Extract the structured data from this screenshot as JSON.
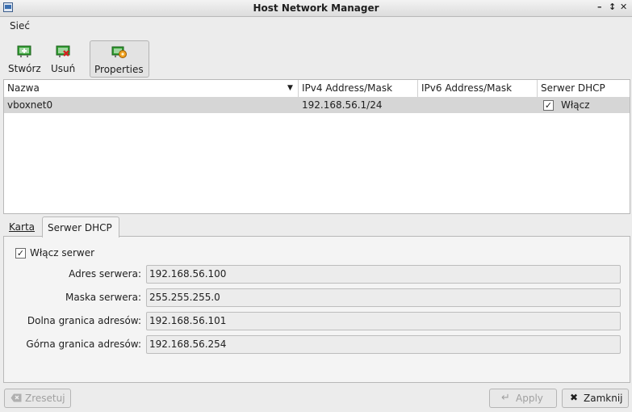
{
  "window": {
    "title": "Host Network Manager"
  },
  "menu": {
    "network": "Sieć"
  },
  "toolbar": {
    "create": "Stwórz",
    "remove": "Usuń",
    "properties": "Properties"
  },
  "table": {
    "columns": [
      "Nazwa",
      "IPv4 Address/Mask",
      "IPv6 Address/Mask",
      "Serwer DHCP"
    ],
    "rows": [
      {
        "name": "vboxnet0",
        "ipv4": "192.168.56.1/24",
        "ipv6": "",
        "dhcp": "Włącz",
        "dhcp_checked": true
      }
    ]
  },
  "tabs": {
    "adapter": "Karta",
    "dhcp": "Serwer DHCP"
  },
  "dhcp": {
    "enable_label": "Włącz serwer",
    "enable_checked": true,
    "server_address_label": "Adres serwera:",
    "server_address": "192.168.56.100",
    "server_mask_label": "Maska serwera:",
    "server_mask": "255.255.255.0",
    "lower_label": "Dolna granica adresów:",
    "lower": "192.168.56.101",
    "upper_label": "Górna granica adresów:",
    "upper": "192.168.56.254"
  },
  "buttons": {
    "reset": "Zresetuj",
    "apply": "Apply",
    "close": "Zamknij"
  }
}
